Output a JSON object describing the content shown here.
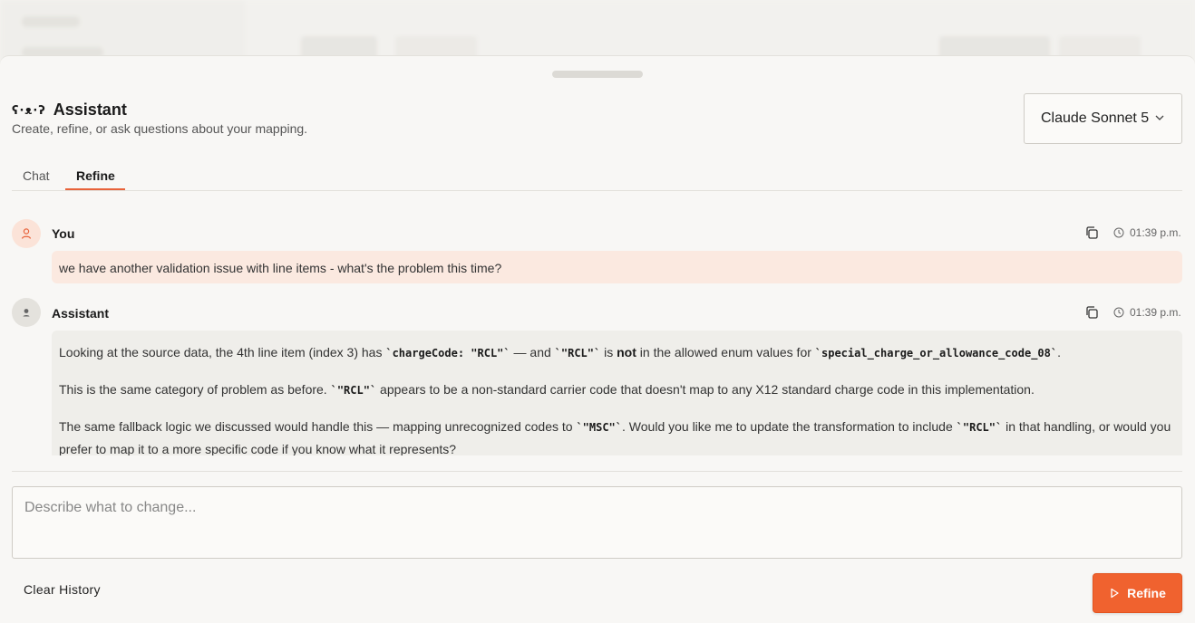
{
  "header": {
    "icon_glyph": "ʕ·ᴥ·ʔ",
    "title": "Assistant",
    "subtitle": "Create, refine, or ask questions about your mapping."
  },
  "model_select": {
    "value": "Claude Sonnet 5"
  },
  "tabs": [
    {
      "label": "Chat",
      "active": false
    },
    {
      "label": "Refine",
      "active": true
    }
  ],
  "messages": [
    {
      "role": "user",
      "name": "You",
      "time": "01:39 p.m.",
      "text": "we have another validation issue with line items - what's the problem this time?"
    },
    {
      "role": "assistant",
      "name": "Assistant",
      "time": "01:39 p.m.",
      "p1": {
        "a": "Looking at the source data, the 4th line item (index 3) has ",
        "code1": "`chargeCode: \"RCL\"`",
        "b": " — and ",
        "code2": "`\"RCL\"`",
        "c": " is ",
        "strong": "not",
        "d": " in the allowed enum values for ",
        "code3": "`special_charge_or_allowance_code_08`",
        "e": "."
      },
      "p2": {
        "a": "This is the same category of problem as before. ",
        "code1": "`\"RCL\"`",
        "b": " appears to be a non-standard carrier code that doesn't map to any X12 standard charge code in this implementation."
      },
      "p3": {
        "a": "The same fallback logic we discussed would handle this — mapping unrecognized codes to ",
        "code1": "`\"MSC\"`",
        "b": ". Would you like me to update the transformation to include ",
        "code2": "`\"RCL\"`",
        "c": " in that handling, or would you prefer to map it to a more specific code if you know what it represents?"
      }
    }
  ],
  "composer": {
    "placeholder": "Describe what to change...",
    "value": ""
  },
  "actions": {
    "clear_label": "Clear History",
    "refine_label": "Refine"
  },
  "colors": {
    "accent": "#f0622f",
    "user_bubble": "#fbe9e0",
    "assistant_bubble": "#efeeea"
  }
}
